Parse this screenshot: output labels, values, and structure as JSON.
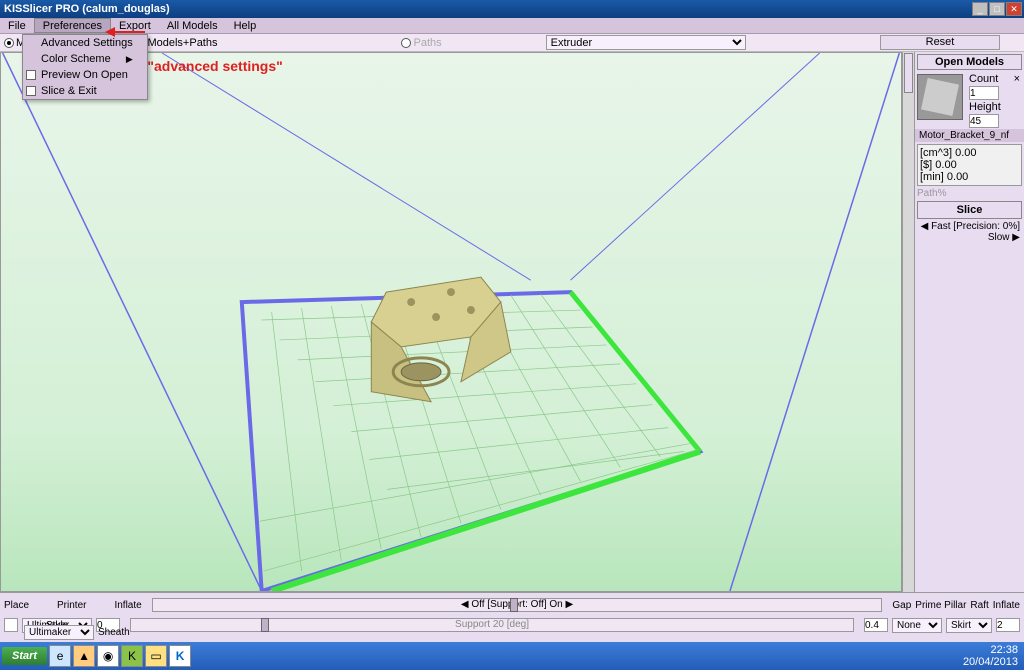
{
  "title": "KISSlicer PRO (calum_douglas)",
  "menu": {
    "file": "File",
    "preferences": "Preferences",
    "export": "Export",
    "allmodels": "All Models",
    "help": "Help"
  },
  "prefs_menu": {
    "advanced": "Advanced Settings",
    "color": "Color Scheme",
    "preview": "Preview On Open",
    "sliceexit": "Slice & Exit"
  },
  "toolbar": {
    "mode_models": "Models",
    "mode_both": "Models+Paths",
    "mode_paths": "Paths",
    "extruder": "Extruder",
    "reset": "Reset"
  },
  "right": {
    "header": "Open Models",
    "count_label": "Count",
    "count": "1",
    "height_label": "Height",
    "height": "45",
    "filename": "Motor_Bracket_9_nf",
    "close_x": "×",
    "info_cm3": "[cm^3]  0.00",
    "info_dollar": "[$]  0.00",
    "info_min": "[min]  0.00",
    "slice": "Slice",
    "path_pct": "Path%"
  },
  "bottom": {
    "place": "Place",
    "printer": "Printer",
    "inflate": "Inflate",
    "inflate_val": "0",
    "printer_sel": "Ultimaker",
    "style": "Style",
    "style_sel": "Ultimaker",
    "sheath": "Sheath",
    "sheath_val": "0",
    "support_status": "◀ Off [Support: Off] On ▶",
    "support_label": "Support 20 [deg]",
    "precision": "◀ Fast [Precision: 0%] Slow ▶",
    "gap": "Gap",
    "gap_val": "0.4",
    "prime": "Prime Pillar",
    "prime_sel": "None",
    "raft": "Raft",
    "raft_sel": "Skirt",
    "inflate2": "Inflate",
    "inflate2_val": "2"
  },
  "taskbar": {
    "start": "Start",
    "time": "22:38",
    "date": "20/04/2013"
  },
  "annotation": "Click \"advanced settings\""
}
